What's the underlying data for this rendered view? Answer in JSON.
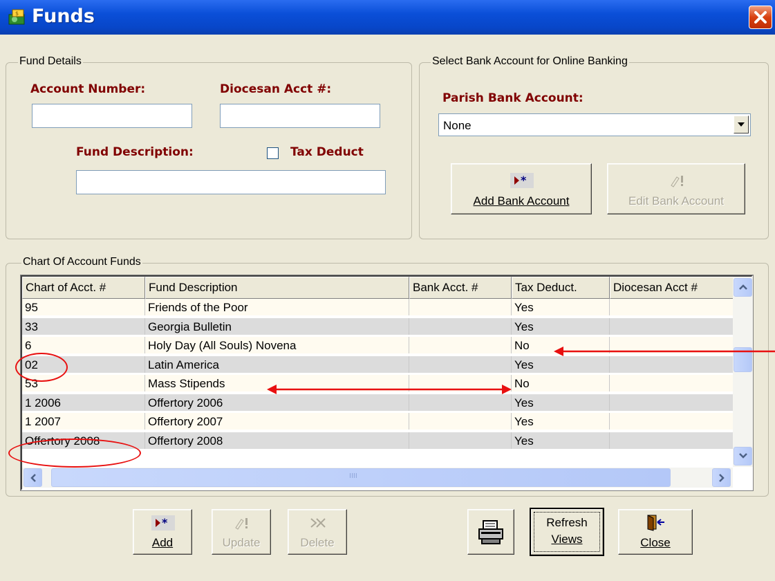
{
  "window": {
    "title": "Funds",
    "close_icon": "close-icon"
  },
  "fund_details": {
    "group_label": "Fund Details",
    "account_number_label": "Account Number:",
    "account_number_value": "",
    "diocesan_acct_label": "Diocesan Acct #:",
    "diocesan_acct_value": "",
    "fund_description_label": "Fund Description:",
    "fund_description_value": "",
    "tax_deduct_label": "Tax Deduct",
    "tax_deduct_checked": false
  },
  "bank": {
    "group_label": "Select Bank Account for Online Banking",
    "parish_bank_label": "Parish Bank Account:",
    "parish_bank_value": "None",
    "add_bank_label": "Add Bank Account",
    "edit_bank_label": "Edit Bank Account"
  },
  "chart": {
    "group_label": "Chart Of Account Funds",
    "columns": [
      "Chart of Acct. #",
      "Fund Description",
      "Bank Acct. #",
      "Tax Deduct.",
      "Diocesan Acct #"
    ],
    "rows": [
      [
        "95",
        "Friends of the Poor",
        "",
        "Yes",
        ""
      ],
      [
        "33",
        "Georgia Bulletin",
        "",
        "Yes",
        ""
      ],
      [
        "6",
        "Holy Day (All Souls)  Novena",
        "",
        "No",
        ""
      ],
      [
        "02",
        "Latin America",
        "",
        "Yes",
        ""
      ],
      [
        "53",
        "Mass Stipends",
        "",
        "No",
        ""
      ],
      [
        "1 2006",
        "Offertory 2006",
        "",
        "Yes",
        ""
      ],
      [
        "1 2007",
        "Offertory 2007",
        "",
        "Yes",
        ""
      ],
      [
        "Offertory 2008",
        "Offertory 2008",
        "",
        "Yes",
        ""
      ]
    ],
    "hscroll_grip": "IIII"
  },
  "buttons": {
    "add": "Add",
    "update": "Update",
    "delete": "Delete",
    "refresh_line1": "Refresh",
    "refresh_line2": "Views",
    "close": "Close"
  },
  "colors": {
    "label_red": "#800000",
    "row_alt": "#dcdcdc",
    "row_base": "#fffbf0",
    "annotation_red": "#e81010"
  }
}
